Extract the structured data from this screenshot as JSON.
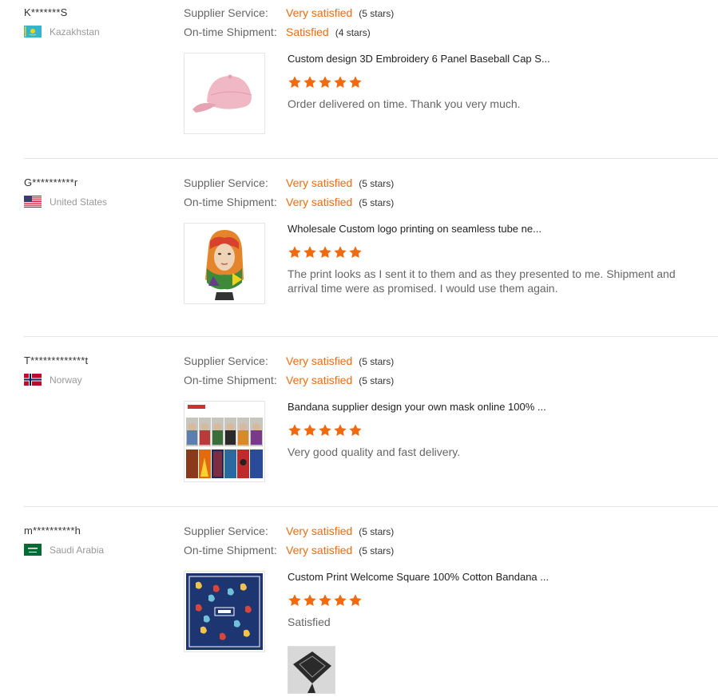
{
  "labels": {
    "supplier_service": "Supplier Service:",
    "on_time_shipment": "On-time Shipment:"
  },
  "colors": {
    "accent": "#f26a10",
    "divider": "#e5e5e5"
  },
  "reviews": [
    {
      "buyer": "K*******S",
      "country": "Kazakhstan",
      "flag_icon": "kazakhstan-flag-icon",
      "supplier_service": {
        "value": "Very satisfied",
        "stars": "(5 stars)"
      },
      "on_time_shipment": {
        "value": "Satisfied",
        "stars": "(4 stars)"
      },
      "product_title": "Custom design 3D Embroidery 6 Panel Baseball Cap S...",
      "product_image": "pink-baseball-cap-image",
      "rating": 5,
      "comment": "Order delivered on time. Thank you very much."
    },
    {
      "buyer": "G**********r",
      "country": "United States",
      "flag_icon": "united-states-flag-icon",
      "supplier_service": {
        "value": "Very satisfied",
        "stars": "(5 stars)"
      },
      "on_time_shipment": {
        "value": "Very satisfied",
        "stars": "(5 stars)"
      },
      "product_title": "Wholesale Custom logo printing on seamless tube ne...",
      "product_image": "mannequin-neck-gaiter-image",
      "rating": 5,
      "comment": "The print looks as I sent it to them and as they presented to me.  Shipment and arrival time were as promised.  I would use them again."
    },
    {
      "buyer": "T*************t",
      "country": "Norway",
      "flag_icon": "norway-flag-icon",
      "supplier_service": {
        "value": "Very satisfied",
        "stars": "(5 stars)"
      },
      "on_time_shipment": {
        "value": "Very satisfied",
        "stars": "(5 stars)"
      },
      "product_title": "Bandana supplier design your own mask online 100% ...",
      "product_image": "bandana-masks-collage-image",
      "rating": 5,
      "comment": "Very good quality and fast delivery."
    },
    {
      "buyer": "m**********h",
      "country": "Saudi Arabia",
      "flag_icon": "saudi-arabia-flag-icon",
      "supplier_service": {
        "value": "Very satisfied",
        "stars": "(5 stars)"
      },
      "on_time_shipment": {
        "value": "Very satisfied",
        "stars": "(5 stars)"
      },
      "product_title": "Custom Print Welcome Square 100% Cotton Bandana ...",
      "product_image": "paisley-bandana-image",
      "rating": 5,
      "comment": "Satisfied",
      "attachment_image": "buyer-photo-bandana-image"
    }
  ]
}
